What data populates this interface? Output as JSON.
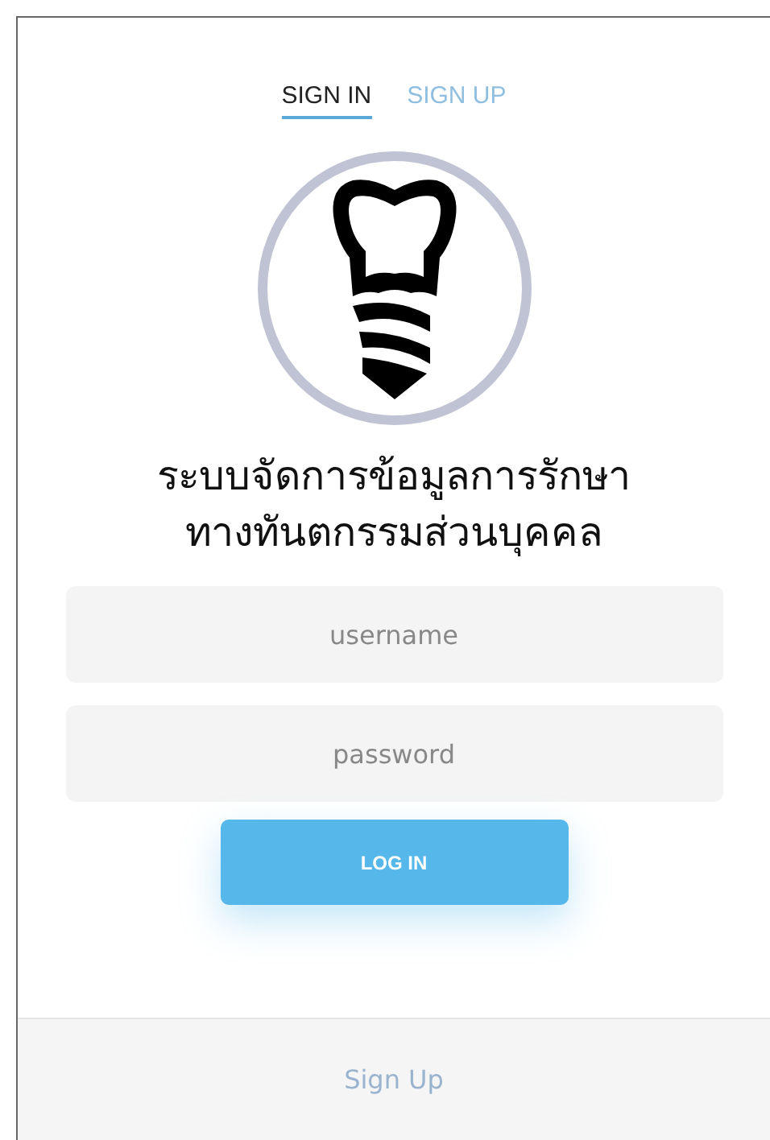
{
  "tabs": [
    {
      "label": "SIGN IN",
      "selected": true
    },
    {
      "label": "SIGN UP",
      "selected": false
    }
  ],
  "title": [
    "ระบบจัดการข้อมูลการรักษา",
    "ทางทันตกรรมส่วนบุคคล"
  ],
  "fields": [
    {
      "placeholder": "username"
    },
    {
      "placeholder": "password"
    }
  ],
  "login_button": "LOG IN",
  "footer_link": "Sign Up"
}
